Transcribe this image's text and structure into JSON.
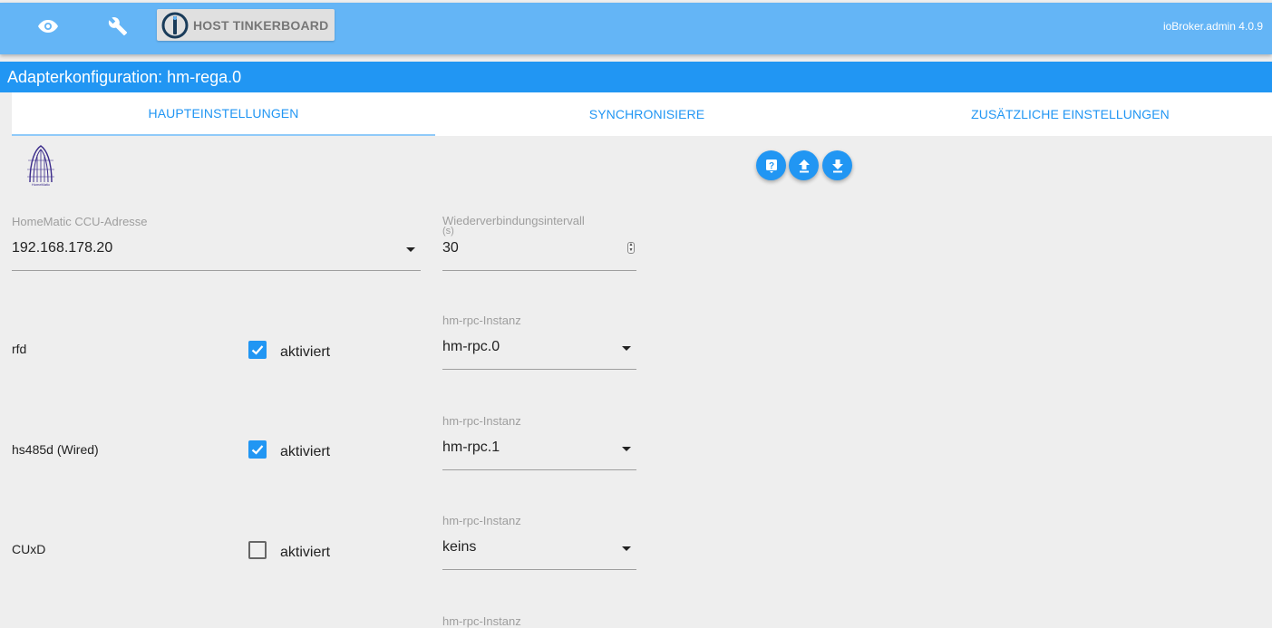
{
  "header": {
    "host_label": "HOST TINKERBOARD",
    "version": "ioBroker.admin 4.0.9",
    "icons": [
      "eye-icon",
      "wrench-icon",
      "iobroker-logo-icon"
    ]
  },
  "title": "Adapterkonfiguration: hm-rega.0",
  "tabs": [
    {
      "label": "HAUPTEINSTELLUNGEN",
      "active": true
    },
    {
      "label": "SYNCHRONISIERE",
      "active": false
    },
    {
      "label": "ZUSÄTZLICHE EINSTELLUNGEN",
      "active": false
    }
  ],
  "adapter_logo_text": "HomeMatic",
  "toolbar_icons": [
    "help-icon",
    "upload-icon",
    "download-icon"
  ],
  "ccu": {
    "label": "HomeMatic CCU-Adresse",
    "value": "192.168.178.20"
  },
  "reconnect": {
    "label_line1": "Wiederverbindungsintervall",
    "label_line2": "(s)",
    "value": "30"
  },
  "rows": [
    {
      "name": "rfd",
      "checkbox_label": "aktiviert",
      "checked": true,
      "instance_label": "hm-rpc-Instanz",
      "instance_value": "hm-rpc.0"
    },
    {
      "name": "hs485d (Wired)",
      "checkbox_label": "aktiviert",
      "checked": true,
      "instance_label": "hm-rpc-Instanz",
      "instance_value": "hm-rpc.1"
    },
    {
      "name": "CUxD",
      "checkbox_label": "aktiviert",
      "checked": false,
      "instance_label": "hm-rpc-Instanz",
      "instance_value": "keins"
    }
  ],
  "partial_label": "hm-rpc-Instanz",
  "colors": {
    "header_bg": "#64b5f6",
    "title_bg": "#2196f3",
    "accent": "#2196f3",
    "page_bg": "#eeeeee"
  }
}
